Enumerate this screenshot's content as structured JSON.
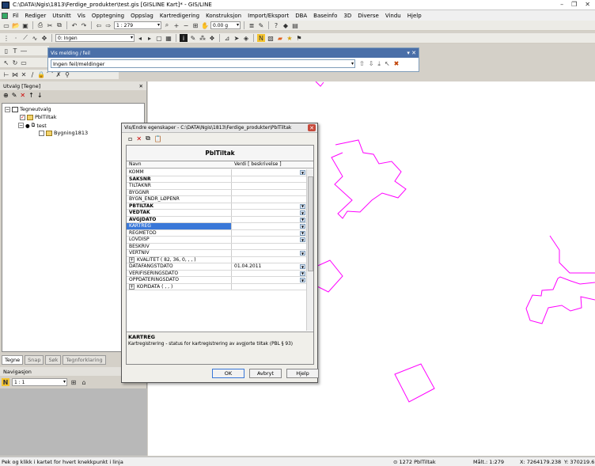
{
  "window": {
    "title": "C:\\DATA\\Ngis\\1813\\Ferdige_produkter\\test.gis [GISLINE Kart]* - GIS/LINE"
  },
  "menu": [
    "Fil",
    "Rediger",
    "Utsnitt",
    "Vis",
    "Opptegning",
    "Oppslag",
    "Kartredigering",
    "Konstruksjon",
    "Import/Eksport",
    "DBA",
    "Baseinfo",
    "3D",
    "Diverse",
    "Vindu",
    "Hjelp"
  ],
  "toolbar": {
    "scale": "1 : 279",
    "value": "0.00 g",
    "layer": "0: Ingen"
  },
  "message_bar": {
    "title": "Vis melding / feil",
    "value": "Ingen feil/meldinger"
  },
  "left_panel": {
    "title": "Utvalg [Tegne]",
    "tree": {
      "root": "Tegneutvalg",
      "child1": "PblTiltak",
      "group": "test",
      "child2": "Bygning1813"
    },
    "tabs": [
      "Tegne",
      "Snap",
      "Søk",
      "Tegnforklaring"
    ]
  },
  "navigation": {
    "title": "Navigasjon",
    "scale": "1 : 1"
  },
  "dialog": {
    "title": "Vis/Endre egenskaper - C:\\DATA\\Ngis\\1813\\Ferdige_produkter\\PblTiltak",
    "grid_title": "PblTiltak",
    "col_name": "Navn",
    "col_value": "Verdi [ beskrivelse ]",
    "rows": [
      {
        "name": "KOMM",
        "value": ""
      },
      {
        "name": "SAKSNR",
        "value": ""
      },
      {
        "name": "TILTAKNR",
        "value": ""
      },
      {
        "name": "BYGGNR",
        "value": ""
      },
      {
        "name": "BYGN_ENDR_LØPENR",
        "value": ""
      },
      {
        "name": "PBTILTAK",
        "value": ""
      },
      {
        "name": "VEDTAK",
        "value": ""
      },
      {
        "name": "AVGJDATO",
        "value": ""
      },
      {
        "name": "KARTREG",
        "value": ""
      },
      {
        "name": "REGMETOD",
        "value": ""
      },
      {
        "name": "LOVDISP",
        "value": ""
      },
      {
        "name": "BESKRIV",
        "value": ""
      },
      {
        "name": "VERTNIV",
        "value": ""
      },
      {
        "name": "KVALITET ( 82, 36, 0, , , )",
        "value": ""
      },
      {
        "name": "DATAFANGSTDATO",
        "value": "01.04.2011"
      },
      {
        "name": "VERIFISERINGSDATO",
        "value": ""
      },
      {
        "name": "OPPDATERINGSDATO",
        "value": ""
      },
      {
        "name": "KOPIDATA ( , , )",
        "value": ""
      }
    ],
    "desc_title": "KARTREG",
    "desc_text": "Kartregistrering - status for kartregistrering av avgjorte tiltak (PBL § 93)",
    "ok": "OK",
    "cancel": "Avbryt",
    "help": "Hjelp"
  },
  "statusbar": {
    "hint": "Pek og klikk i kartet for hvert knekkpunkt i linja",
    "count": "1272 PblTiltak",
    "scale": "Målt.: 1:279",
    "x": "X: 7264179.238",
    "y": "Y: 370219.6"
  },
  "colors": {
    "polygon": "#ff00ff",
    "selection": "#3a78d8",
    "message_head": "#4a6fa8"
  }
}
